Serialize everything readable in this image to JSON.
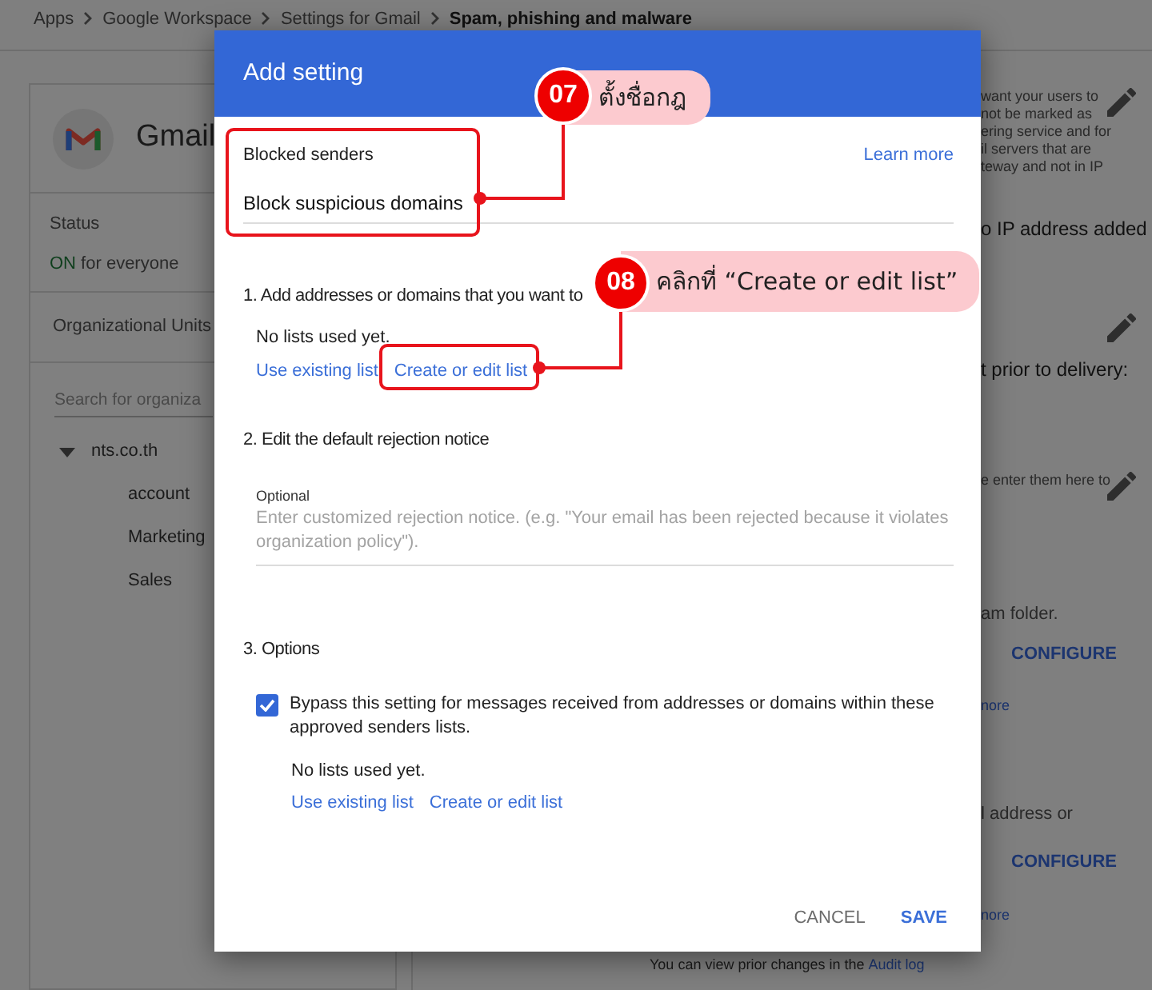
{
  "breadcrumb": [
    "Apps",
    "Google Workspace",
    "Settings for Gmail",
    "Spam, phishing and malware"
  ],
  "app_card": {
    "name": "Gmail",
    "status_label": "Status",
    "status_value": "ON",
    "status_detail": "for everyone",
    "org_units_label": "Organizational Units",
    "search": {
      "placeholder": "Search for organiza"
    },
    "org_tree": [
      {
        "label": "nts.co.th",
        "expanded": true,
        "children": [
          {
            "label": "account"
          },
          {
            "label": "Marketing"
          },
          {
            "label": "Sales"
          }
        ]
      }
    ]
  },
  "right_panel": [
    {
      "kind": "note",
      "lines": [
        "want your users to",
        "not be marked as",
        "ering service and for",
        "il servers that are",
        "teway and not in IP"
      ],
      "editable": true
    },
    {
      "kind": "value",
      "text": "o IP address added"
    },
    {
      "kind": "edit"
    },
    {
      "kind": "value",
      "text": "t prior to delivery:"
    },
    {
      "kind": "note",
      "lines": [
        "e enter them here to"
      ],
      "editable": true
    },
    {
      "kind": "text",
      "text": "am folder."
    },
    {
      "kind": "button",
      "text": "CONFIGURE"
    },
    {
      "kind": "link",
      "text": "nore"
    },
    {
      "kind": "text",
      "text": "l address or"
    },
    {
      "kind": "button",
      "text": "CONFIGURE"
    },
    {
      "kind": "link",
      "text": "nore"
    }
  ],
  "audit_note": {
    "text": "You can view prior changes in the ",
    "link": "Audit log"
  },
  "dialog": {
    "title": "Add setting",
    "name_field": {
      "label": "Blocked senders",
      "value": "Block suspicious domains"
    },
    "learn_more": "Learn more",
    "sections": [
      {
        "heading": "1. Add addresses or domains that you want to",
        "kind": "lists",
        "status": "No lists used yet.",
        "links": [
          "Use existing list",
          "Create or edit list"
        ]
      },
      {
        "heading": "2. Edit the default rejection notice",
        "kind": "notice",
        "label": "Optional",
        "placeholder": "Enter customized rejection notice. (e.g. \"Your email has been rejected because it violates organization policy\")."
      },
      {
        "heading": "3. Options",
        "kind": "options",
        "options": [
          {
            "label": "Bypass this setting for messages received from addresses or domains within these approved senders lists.",
            "checked": true,
            "status": "No lists used yet.",
            "links": [
              "Use existing list",
              "Create or edit list"
            ]
          }
        ]
      }
    ],
    "buttons": [
      {
        "label": "CANCEL",
        "kind": "secondary"
      },
      {
        "label": "SAVE",
        "kind": "primary"
      }
    ]
  },
  "callouts": [
    {
      "number": "07",
      "text": "ตั้งชื่อกฎ"
    },
    {
      "number": "08",
      "text": "คลิกที่ “Create or edit list”"
    }
  ]
}
